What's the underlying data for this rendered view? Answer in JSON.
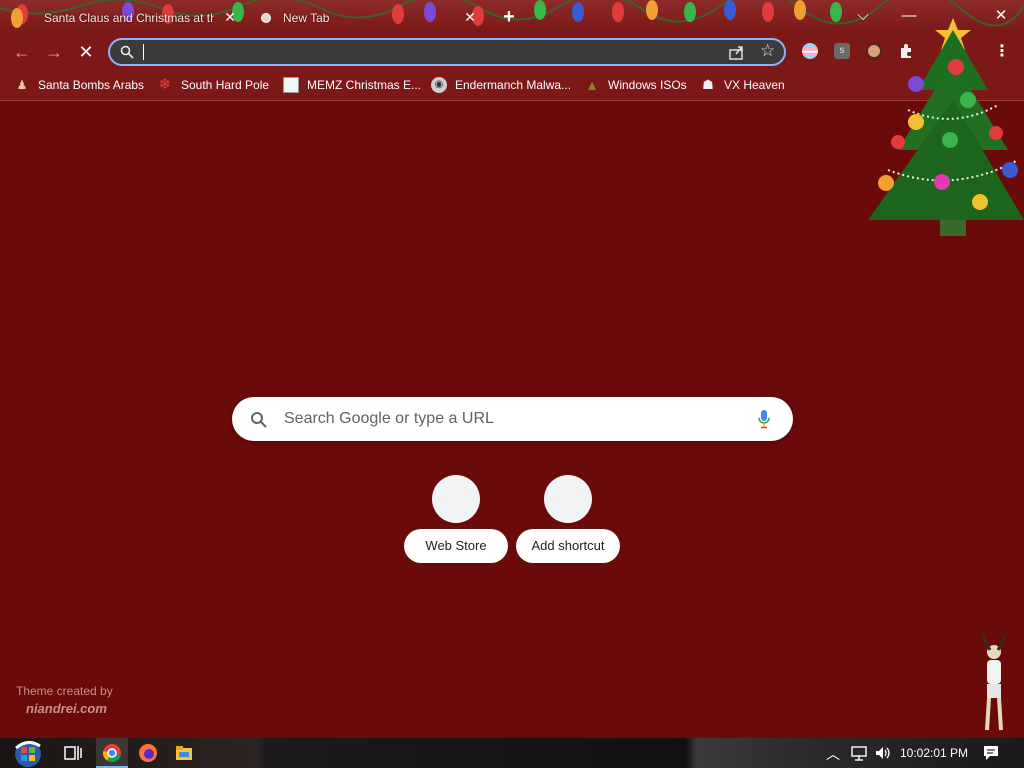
{
  "tabs": [
    {
      "title": "Santa Claus and Christmas at the",
      "active": false
    },
    {
      "title": "New Tab",
      "active": true
    }
  ],
  "tab_close_glyph": "✕",
  "new_tab_glyph": "+",
  "window_controls": {
    "dropdown": "⌵",
    "minimize": "—",
    "close": "✕"
  },
  "toolbar": {
    "back": "←",
    "forward": "→",
    "stop": "✕",
    "omnibox_value": "",
    "star": "☆"
  },
  "bookmarks": [
    {
      "label": "Santa Bombs Arabs",
      "icon": "santa-icon"
    },
    {
      "label": "South Hard Pole",
      "icon": "snowflake-icon"
    },
    {
      "label": "MEMZ Christmas E...",
      "icon": "page-icon"
    },
    {
      "label": "Endermanch Malwa...",
      "icon": "creature-icon"
    },
    {
      "label": "Windows ISOs",
      "icon": "tree-icon"
    },
    {
      "label": "VX Heaven",
      "icon": "vx-icon"
    }
  ],
  "search": {
    "placeholder": "Search Google or type a URL"
  },
  "shortcuts": [
    {
      "label": "Web Store"
    },
    {
      "label": "Add shortcut"
    }
  ],
  "theme_credit": {
    "line1": "Theme created by",
    "line2": "niandrei.com"
  },
  "taskbar": {
    "clock": "10:02:01 PM"
  },
  "colors": {
    "page_bg": "#6b0a0a",
    "toolbar_bg": "#7c1818",
    "focus_ring": "#8ab4f8"
  }
}
